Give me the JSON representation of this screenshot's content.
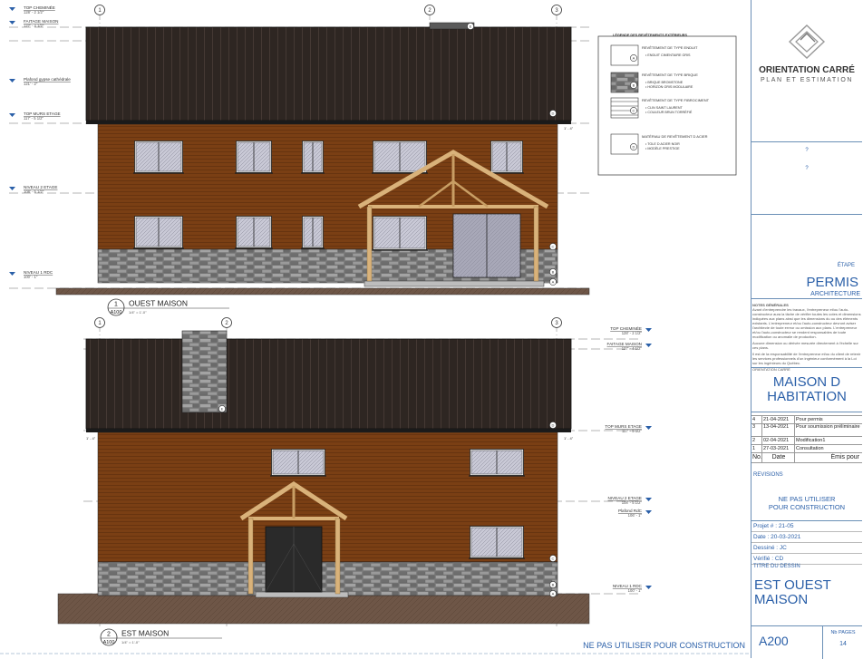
{
  "top_elevation": {
    "grid_markers": [
      "1",
      "2",
      "3"
    ],
    "levels": [
      {
        "name": "TOP CHEMINÉE",
        "value": "128' - 2 1/2\""
      },
      {
        "name": "FAITAGE MAISON",
        "value": "127' - 4 1/2\""
      },
      {
        "name": "Plafond gypse cathédrale",
        "value": "121' - 2\""
      },
      {
        "name": "TOP MURS ETAGE",
        "value": "117' - 5 1/2\""
      },
      {
        "name": "NIVEAU 2 ETAGE",
        "value": "108' - 5 1/2\""
      },
      {
        "name": "NIVEAU 1 RDC",
        "value": "100' - 1\""
      }
    ],
    "material_tags": [
      "A",
      "B",
      "C",
      "D",
      "E"
    ],
    "dim_note": "1' - 4\"",
    "title_number": "1",
    "title_sheet": "A100",
    "title_name": "OUEST MAISON",
    "title_scale": "1/4\" = 1'-0\""
  },
  "legend": {
    "title": "LÉGENDE DES REVÊTEMENTS EXTÉRIEURS",
    "groups": [
      {
        "tag": "A",
        "heading": "REVÊTEMENT DE TYPE ENDUIT",
        "items": [
          "ENDUIT CIMENTAIRE GRIS"
        ]
      },
      {
        "tag": "B",
        "heading": "REVÊTEMENT DE TYPE BRIQUE",
        "items": [
          "BRIQUE BROMSTONE",
          "HORIZON GRIS MODULAIRE"
        ]
      },
      {
        "tag": "C",
        "heading": "REVÊTEMENT DE TYPE FIBROCIMENT",
        "items": [
          "CLIN SAINT LAURENT",
          "COULEUR BRUN TORRÉFIÉ"
        ]
      },
      {
        "tag": "D",
        "heading": "MATÉRIAU DE REVÊTEMENT D ACIER",
        "items": [
          "TOLE D ACIER NOIR",
          "MODÈLE PRESTIGE"
        ]
      }
    ]
  },
  "bottom_elevation": {
    "grid_markers": [
      "1",
      "2",
      "3"
    ],
    "levels": [
      {
        "name": "TOP CHEMINÉE",
        "value": "128' - 2 1/2\""
      },
      {
        "name": "FAITAGE MAISON",
        "value": "127' - 4 1/2\""
      },
      {
        "name": "TOP MURS ETAGE",
        "value": "117' - 5 1/2\""
      },
      {
        "name": "NIVEAU 2 ETAGE",
        "value": "108' - 5 1/2\""
      },
      {
        "name": "Plafond RdC",
        "value": "106' - 1\""
      },
      {
        "name": "NIVEAU 1 RDC",
        "value": "100' - 1\""
      }
    ],
    "material_tags": [
      "A",
      "B",
      "C",
      "D",
      "E"
    ],
    "dim_note": "1' - 4\"",
    "title_number": "2",
    "title_sheet": "A100",
    "title_name": "EST MAISON",
    "title_scale": "1/4\" = 1'-0\""
  },
  "footer_warning": "NE PAS UTILISER POUR CONSTRUCTION",
  "title_block": {
    "company_line1": "ORIENTATION CARRÉ",
    "company_line2": "PLAN ET ESTIMATION",
    "client_lines": [
      "?",
      "?"
    ],
    "stage_label": "ÉTAPE",
    "stage_value": "PERMIS",
    "stage_sub": "ARCHITECTURE",
    "notes_title": "NOTES GÉNÉRALES",
    "notes_text": "Avant d'entreprendre les travaux, l'entrepreneur et/ou l'auto-constructeur aura la tâche de vérifier toutes les cotes et dimensions indiquées aux plans ainsi que les dimensions du ou des éléments existants. L'entrepreneur et/ou l'auto-constructeur devront aviser l'architecte de toute erreur ou omission aux plans. L'entrepreneur et/ou l'auto-constructeur se rendent responsables de toute modification ou anomalie de production.",
    "notes_text2": "Aucune dimension ou dérivée mesurée directement à l'échelle sur ces plans.",
    "notes_text3": "Il est de la responsabilité de l'entrepreneur et/ou du client de retenir les services professionnels d'un ingénieur conformément à la Loi sur les ingénieurs du Québec.",
    "notes_sign": "ORIENTATION CARRÉ",
    "project_title": "MAISON D HABITATION",
    "revisions": [
      {
        "no": "4",
        "date": "21-04-2021",
        "desc": "Pour permis"
      },
      {
        "no": "3",
        "date": "13-04-2021",
        "desc": "Pour soumission préliminaire"
      },
      {
        "no": "2",
        "date": "02-04-2021",
        "desc": "Modification1"
      },
      {
        "no": "1",
        "date": "27-03-2021",
        "desc": "Consultation"
      }
    ],
    "rev_header": {
      "no": "No.",
      "date": "Date",
      "desc": "Émis pour"
    },
    "revisions_label": "REVISIONS",
    "warning_line1": "NE PAS UTILISER",
    "warning_line2": "POUR CONSTRUCTION",
    "project_no": "Projet # : 21-05",
    "date": "Date : 20-03-2021",
    "drawn_by": "Dessiné : JC",
    "checked_by": "Vérifié : CD",
    "drawing_title_label": "TITRE DU DESSIN",
    "drawing_title": "EST OUEST MAISON",
    "sheet_number": "A200",
    "pages_label": "Nb PAGES",
    "pages_value": "14"
  },
  "colors": {
    "wood": "#7a3f14",
    "roof": "#2e2622",
    "stone": "#7d7d7d",
    "timber": "#d9b27a",
    "accent_blue": "#2a5fa8"
  }
}
